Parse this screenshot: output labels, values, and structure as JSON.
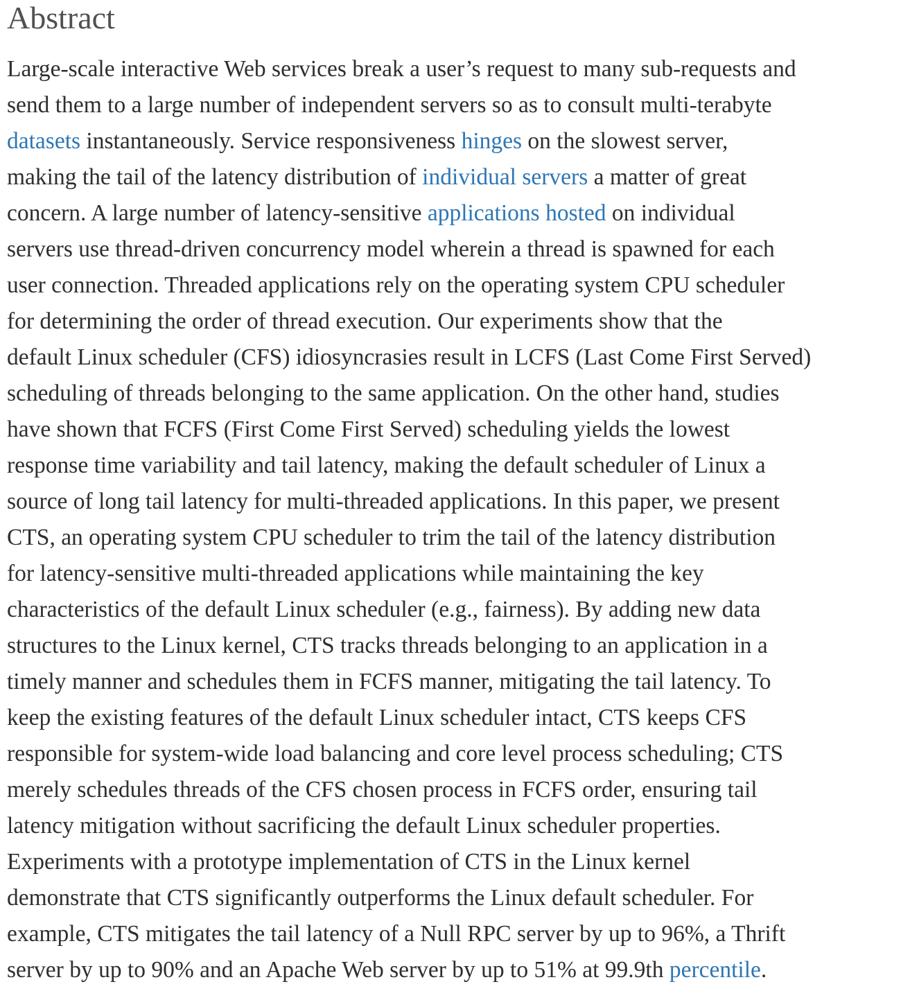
{
  "heading": "Abstract",
  "abstract": {
    "l1": "Large-scale interactive Web services break a user’s request to many sub-requests and",
    "l2": "send them to a large number of independent servers so as to consult multi-terabyte",
    "l3_link1": "datasets",
    "l3_text1": " instantaneously. Service responsiveness ",
    "l3_link2": "hinges",
    "l3_text2": " on the slowest server,",
    "l4_text1": "making the tail of the latency distribution of ",
    "l4_link1": "individual servers",
    "l4_text2": " a matter of great",
    "l5_text1": "concern. A large number of latency-sensitive ",
    "l5_link1": "applications hosted",
    "l5_text2": " on individual",
    "l6": "servers use thread-driven concurrency model wherein a thread is spawned for each",
    "l7": "user connection. Threaded applications rely on the operating system CPU scheduler",
    "l8": "for determining the order of thread execution. Our experiments show that the",
    "l9": "default Linux scheduler (CFS) idiosyncrasies result in LCFS (Last Come First Served)",
    "l10": "scheduling of threads belonging to the same application. On the other hand, studies",
    "l11": "have shown that FCFS (First Come First Served) scheduling yields the lowest",
    "l12": "response time variability and tail latency, making the default scheduler of Linux a",
    "l13": "source of long tail latency for multi-threaded applications. In this paper, we present",
    "l14": "CTS, an operating system CPU scheduler to trim the tail of the latency distribution",
    "l15": "for latency-sensitive multi-threaded applications while maintaining the key",
    "l16": "characteristics of the default Linux scheduler (e.g., fairness). By adding new data",
    "l17": "structures to the Linux kernel, CTS tracks threads belonging to an application in a",
    "l18": "timely manner and schedules them in FCFS manner, mitigating the tail latency. To",
    "l19": "keep the existing features of the default Linux scheduler intact, CTS keeps CFS",
    "l20": "responsible for system-wide load balancing and core level process scheduling; CTS",
    "l21": "merely schedules threads of the CFS chosen process in FCFS order, ensuring tail",
    "l22": "latency mitigation without sacrificing the default Linux scheduler properties.",
    "l23": "Experiments with a prototype implementation of CTS in the Linux kernel",
    "l24": "demonstrate that CTS significantly outperforms the Linux default scheduler. For",
    "l25": "example, CTS mitigates the tail latency of a Null RPC server by up to 96%, a Thrift",
    "l26_text1": "server by up to 90% and an Apache Web server by up to 51% at 99.9th ",
    "l26_link1": "percentile",
    "l26_text2": "."
  },
  "colors": {
    "text": "#2e2e2e",
    "heading": "#505050",
    "link": "#2e76b3"
  }
}
